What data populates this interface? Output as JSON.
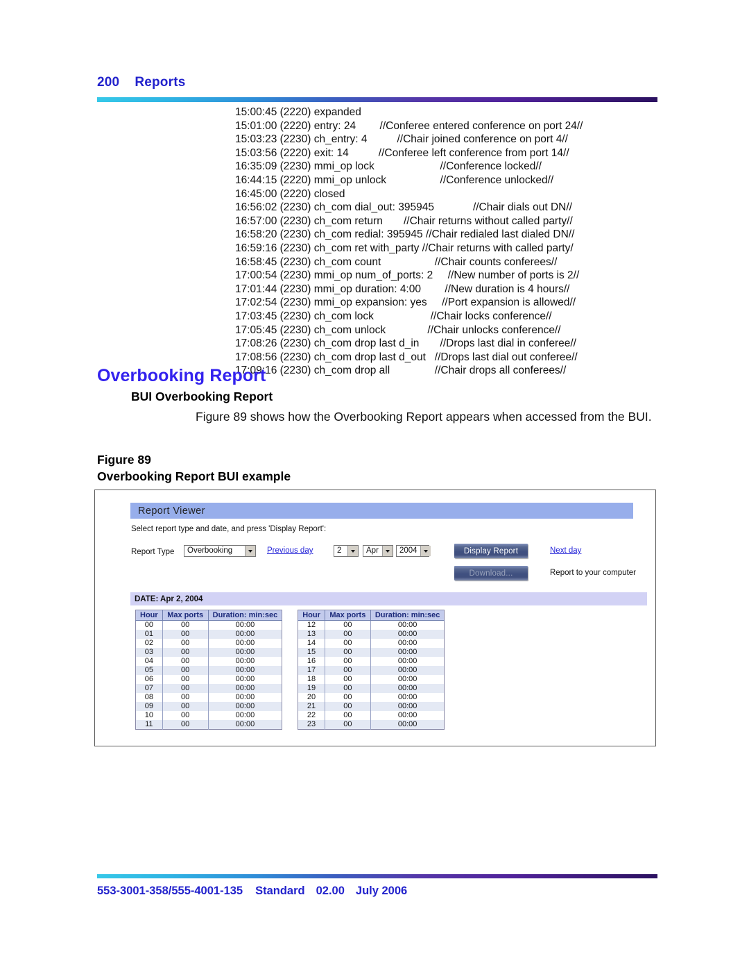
{
  "header": {
    "page_number": "200",
    "chapter_title": "Reports"
  },
  "log": {
    "lines": [
      "15:00:45 (2220) expanded",
      "15:01:00 (2220) entry: 24        //Conferee entered conference on port 24//",
      "15:03:23 (2230) ch_entry: 4          //Chair joined conference on port 4//",
      "15:03:56 (2220) exit: 14          //Conferee left conference from port 14//",
      "16:35:09 (2230) mmi_op lock                      //Conference locked//",
      "16:44:15 (2220) mmi_op unlock                  //Conference unlocked//",
      "16:45:00 (2220) closed",
      "16:56:02 (2230) ch_com dial_out: 395945             //Chair dials out DN//",
      "16:57:00 (2230) ch_com return       //Chair returns without called party//",
      "16:58:20 (2230) ch_com redial: 395945 //Chair redialed last dialed DN//",
      "16:59:16 (2230) ch_com ret with_party //Chair returns with called party/",
      "16:58:45 (2230) ch_com count                  //Chair counts conferees//",
      "17:00:54 (2230) mmi_op num_of_ports: 2     //New number of ports is 2//",
      "17:01:44 (2230) mmi_op duration: 4:00        //New duration is 4 hours//",
      "17:02:54 (2230) mmi_op expansion: yes     //Port expansion is allowed//",
      "17:03:45 (2230) ch_com lock                   //Chair locks conference//",
      "17:05:45 (2230) ch_com unlock              //Chair unlocks conference//",
      "17:08:26 (2230) ch_com drop last d_in       //Drops last dial in conferee//",
      "17:08:56 (2230) ch_com drop last d_out   //Drops last dial out conferee//",
      "17:09:16 (2230) ch_com drop all               //Chair drops all conferees//"
    ]
  },
  "section": {
    "heading": "Overbooking Report",
    "subheading": "BUI Overbooking Report",
    "paragraph": "Figure 89 shows how the Overbooking Report appears when accessed from the BUI.",
    "figure_number": "Figure 89",
    "figure_caption": "Overbooking Report BUI example"
  },
  "report_viewer": {
    "title": "Report Viewer",
    "instruction": "Select report type and date, and press 'Display Report':",
    "report_type_label": "Report Type",
    "report_type_value": "Overbooking",
    "previous_day_link": "Previous day",
    "next_day_link": "Next day",
    "day_value": "2",
    "month_value": "Apr",
    "year_value": "2004",
    "display_report_button": "Display Report",
    "download_button": "Download...",
    "download_note": "Report to your computer",
    "date_bar": "DATE: Apr 2, 2004",
    "columns": [
      "Hour",
      "Max ports",
      "Duration: min:sec"
    ],
    "table_left": [
      [
        "00",
        "00",
        "00:00"
      ],
      [
        "01",
        "00",
        "00:00"
      ],
      [
        "02",
        "00",
        "00:00"
      ],
      [
        "03",
        "00",
        "00:00"
      ],
      [
        "04",
        "00",
        "00:00"
      ],
      [
        "05",
        "00",
        "00:00"
      ],
      [
        "06",
        "00",
        "00:00"
      ],
      [
        "07",
        "00",
        "00:00"
      ],
      [
        "08",
        "00",
        "00:00"
      ],
      [
        "09",
        "00",
        "00:00"
      ],
      [
        "10",
        "00",
        "00:00"
      ],
      [
        "11",
        "00",
        "00:00"
      ]
    ],
    "table_right": [
      [
        "12",
        "00",
        "00:00"
      ],
      [
        "13",
        "00",
        "00:00"
      ],
      [
        "14",
        "00",
        "00:00"
      ],
      [
        "15",
        "00",
        "00:00"
      ],
      [
        "16",
        "00",
        "00:00"
      ],
      [
        "17",
        "00",
        "00:00"
      ],
      [
        "18",
        "00",
        "00:00"
      ],
      [
        "19",
        "00",
        "00:00"
      ],
      [
        "20",
        "00",
        "00:00"
      ],
      [
        "21",
        "00",
        "00:00"
      ],
      [
        "22",
        "00",
        "00:00"
      ],
      [
        "23",
        "00",
        "00:00"
      ]
    ]
  },
  "footer": {
    "doc_number": "553-3001-358/555-4001-135",
    "standard": "Standard",
    "version": "02.00",
    "date": "July 2006"
  },
  "colors": {
    "heading_blue": "#3322ee",
    "link_blue": "#2424d8",
    "titlebar_blue": "#97aeeb",
    "date_bar_lavender": "#d2d2f5",
    "table_header_blue": "#c3cbec",
    "button_navy": "#3f5080"
  }
}
